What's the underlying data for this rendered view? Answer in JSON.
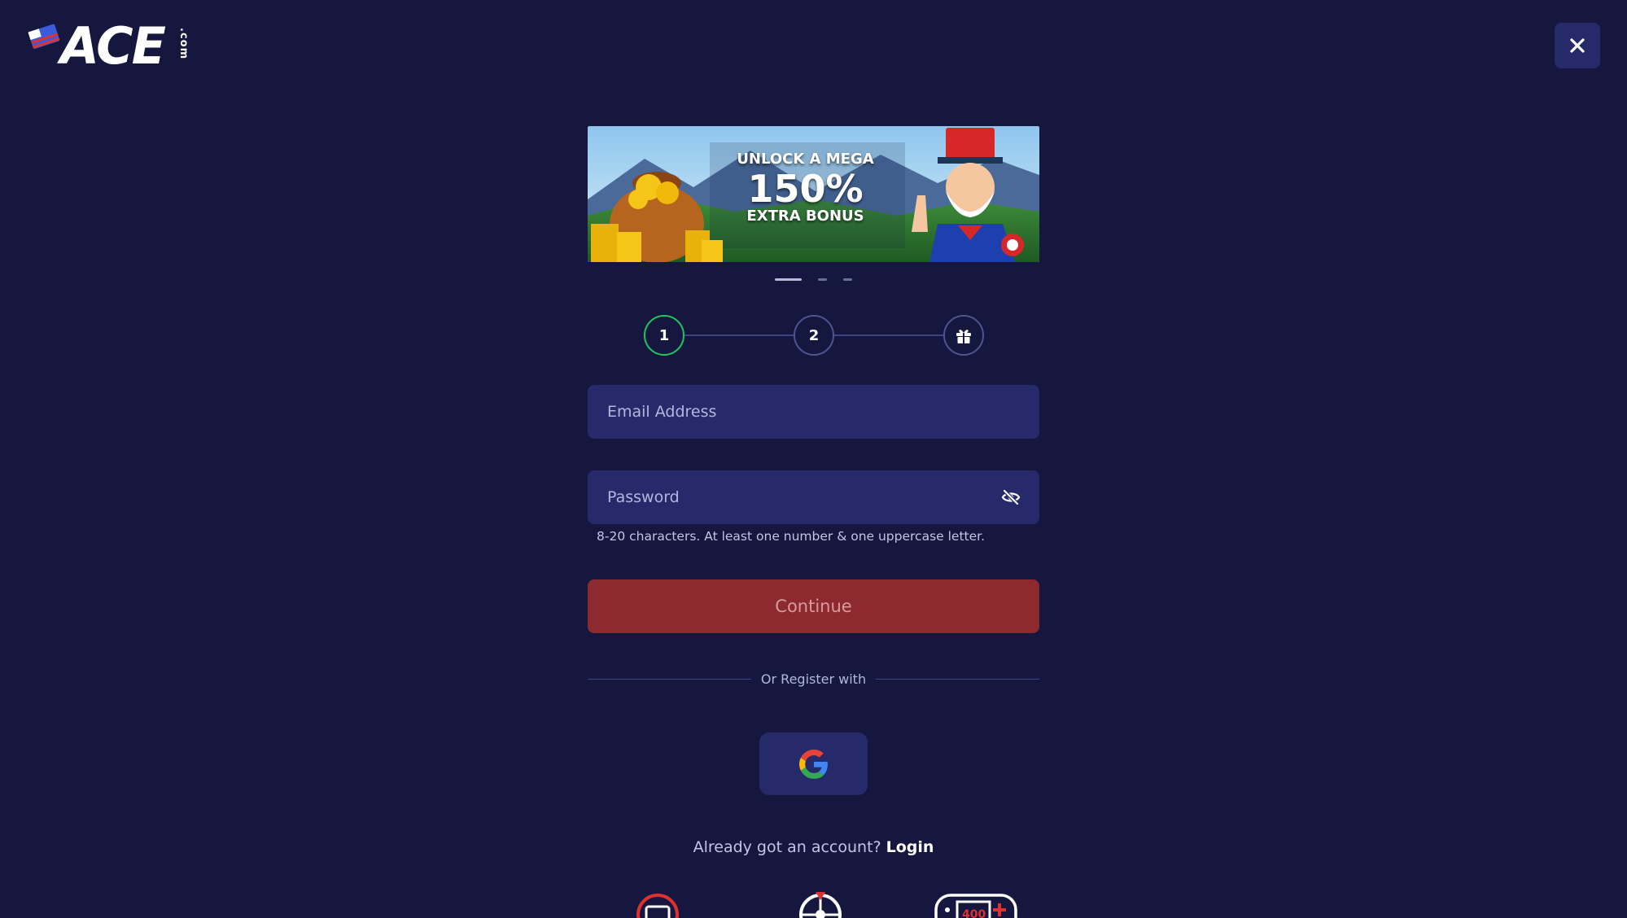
{
  "brand": {
    "logo_text": "ACE",
    "logo_suffix": ".com"
  },
  "header": {
    "close_icon": "close-icon"
  },
  "banner": {
    "line1": "UNLOCK A MEGA",
    "line2": "150%",
    "line3": "EXTRA BONUS"
  },
  "carousel": {
    "slide_count": 3,
    "active_index": 0
  },
  "steps": [
    {
      "label": "1",
      "active": true
    },
    {
      "label": "2",
      "active": false
    },
    {
      "label": "",
      "icon": "gift-icon",
      "active": false
    }
  ],
  "form": {
    "email_placeholder": "Email Address",
    "email_value": "",
    "password_placeholder": "Password",
    "password_value": "",
    "password_hint": "8-20 characters. At least one number & one uppercase letter.",
    "continue_label": "Continue"
  },
  "social": {
    "divider_text": "Or Register with",
    "google_icon": "google-icon"
  },
  "footer": {
    "login_prompt": "Already got an account?",
    "login_link": "Login"
  },
  "colors": {
    "background": "#15173f",
    "field": "#262a6b",
    "accent_red": "#8c2a30",
    "step_active": "#22c55e"
  }
}
